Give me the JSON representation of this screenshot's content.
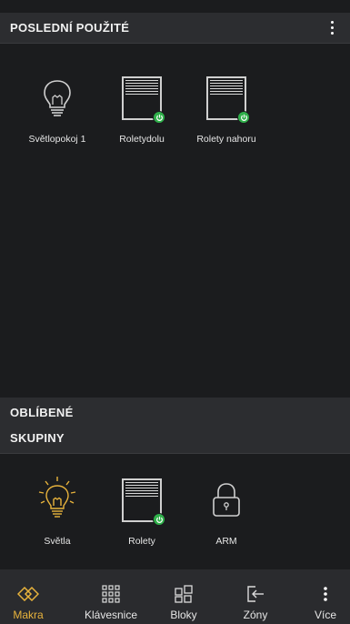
{
  "recent": {
    "title": "POSLEDNÍ POUŽITÉ",
    "items": [
      {
        "label": "Světlopokoj 1",
        "icon": "bulb-icon"
      },
      {
        "label": "Roletydolu",
        "icon": "blinds-icon"
      },
      {
        "label": "Rolety nahoru",
        "icon": "blinds-icon"
      }
    ]
  },
  "favorites": {
    "title": "OBLÍBENÉ"
  },
  "groups": {
    "title": "SKUPINY",
    "items": [
      {
        "label": "Světla",
        "icon": "bulb-lit-icon"
      },
      {
        "label": "Rolety",
        "icon": "blinds-icon"
      },
      {
        "label": "ARM",
        "icon": "lock-icon"
      }
    ]
  },
  "nav": {
    "items": [
      {
        "label": "Makra",
        "icon": "macro-icon",
        "active": true
      },
      {
        "label": "Klávesnice",
        "icon": "keypad-icon",
        "active": false
      },
      {
        "label": "Bloky",
        "icon": "blocks-icon",
        "active": false
      },
      {
        "label": "Zóny",
        "icon": "zone-exit-icon",
        "active": false
      },
      {
        "label": "Více",
        "icon": "more-icon",
        "active": false
      }
    ]
  },
  "colors": {
    "background": "#1b1c1e",
    "header": "#2c2d30",
    "accent": "#e8b33c",
    "status_on": "#2fb04a"
  }
}
